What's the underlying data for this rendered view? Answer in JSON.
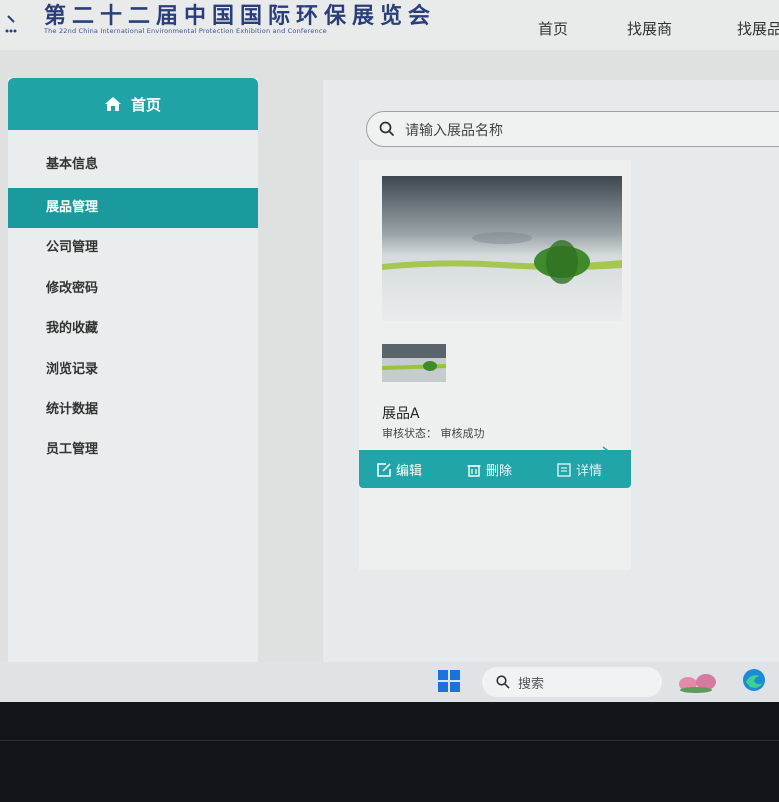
{
  "header": {
    "title_cn": "第二十二届中国国际环保展览会",
    "title_en": "The 22nd China International Environmental Protection Exhibition and Conference",
    "nav": [
      "首页",
      "找展商",
      "找展品"
    ]
  },
  "sidebar": {
    "home_label": "首页",
    "items": [
      {
        "label": "基本信息"
      },
      {
        "label": "展品管理",
        "active": true
      },
      {
        "label": "公司管理"
      },
      {
        "label": "修改密码"
      },
      {
        "label": "我的收藏"
      },
      {
        "label": "浏览记录"
      },
      {
        "label": "统计数据"
      },
      {
        "label": "员工管理"
      }
    ]
  },
  "main": {
    "search_placeholder": "请输入展品名称",
    "card": {
      "name": "展品A",
      "status_label": "审核状态：",
      "status_value": "审核成功",
      "actions": {
        "edit": "编辑",
        "delete": "删除",
        "detail": "详情"
      }
    }
  },
  "taskbar": {
    "search_label": "搜索"
  },
  "colors": {
    "accent": "#1fa3a7",
    "logo": "#2a3f7a"
  }
}
